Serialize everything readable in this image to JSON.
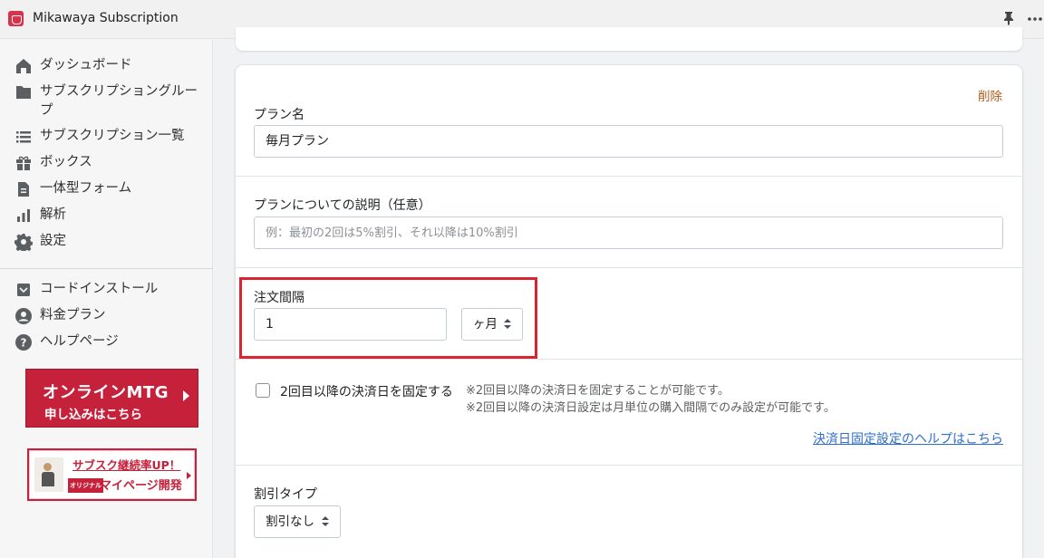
{
  "app": {
    "title": "Mikawaya Subscription"
  },
  "topbar_icons": [
    "pin-icon",
    "more-icon"
  ],
  "sidebar": {
    "items": [
      {
        "label": "ダッシュボード",
        "icon": "home-icon"
      },
      {
        "label": "サブスクリプショングループ",
        "icon": "folder-icon"
      },
      {
        "label": "サブスクリプション一覧",
        "icon": "list-icon"
      },
      {
        "label": "ボックス",
        "icon": "gift-icon"
      },
      {
        "label": "一体型フォーム",
        "icon": "document-icon"
      },
      {
        "label": "解析",
        "icon": "bar-chart-icon"
      },
      {
        "label": "設定",
        "icon": "gear-icon"
      }
    ],
    "secondary_items": [
      {
        "label": "コードインストール",
        "icon": "inbox-icon"
      },
      {
        "label": "料金プラン",
        "icon": "user-circle-icon"
      },
      {
        "label": "ヘルプページ",
        "icon": "question-icon"
      }
    ],
    "banner_mtg": {
      "line1": "オンラインMTG",
      "line2": "申し込みはこちら"
    },
    "banner_mypage": {
      "line1": "サブスク継続率UP！",
      "tag": "オリジナル",
      "line2": "マイページ開発"
    }
  },
  "form": {
    "delete_label": "削除",
    "plan_name": {
      "label": "プラン名",
      "value": "毎月プラン"
    },
    "plan_description": {
      "label": "プランについての説明（任意）",
      "placeholder": "例：最初の2回は5%割引、それ以降は10%割引"
    },
    "order_interval": {
      "label": "注文間隔",
      "value": "1",
      "unit_selected": "ヶ月"
    },
    "fixed_billing": {
      "checkbox_label": "2回目以降の決済日を固定する",
      "checked": false,
      "note1": "※2回目以降の決済日を固定することが可能です。",
      "note2": "※2回目以降の決済日設定は月単位の購入間隔でのみ設定が可能です。",
      "help_link": "決済日固定設定のヘルプはこちら"
    },
    "discount_type": {
      "label": "割引タイプ",
      "selected": "割引なし"
    }
  },
  "colors": {
    "brand": "#c6213b",
    "highlight_box": "#d7262f",
    "link": "#2c6ecb",
    "delete": "#b15a1b"
  }
}
